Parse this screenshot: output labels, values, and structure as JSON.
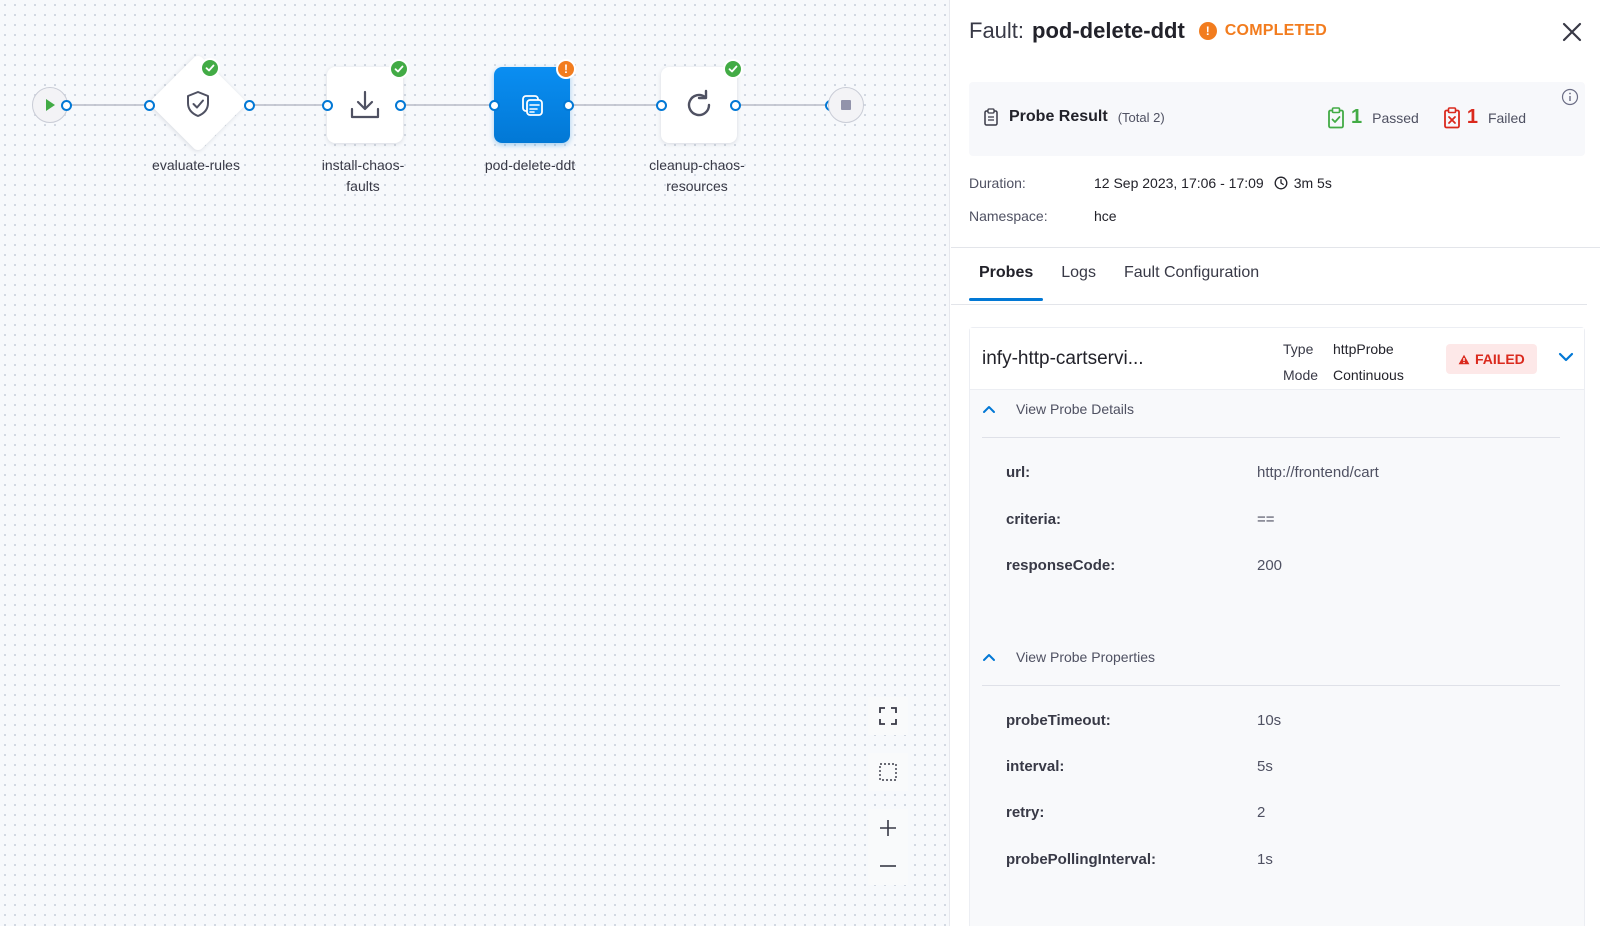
{
  "pipeline": {
    "nodes": [
      {
        "label_line1": "evaluate-rules",
        "label_line2": "",
        "status": "passed",
        "icon": "shield-check-icon"
      },
      {
        "label_line1": "install-chaos-",
        "label_line2": "faults",
        "status": "passed",
        "icon": "download-icon"
      },
      {
        "label_line1": "pod-delete-ddt",
        "label_line2": "",
        "status": "warning",
        "icon": "chaos-fault-icon"
      },
      {
        "label_line1": "cleanup-chaos-",
        "label_line2": "resources",
        "status": "passed",
        "icon": "refresh-icon"
      }
    ],
    "warning_glyph": "!"
  },
  "canvas_tools": [
    "fit-to-screen-icon",
    "select-area-icon",
    "zoom-in-icon",
    "zoom-out-icon"
  ],
  "panel": {
    "fault_prefix": "Fault:",
    "fault_name": "pod-delete-ddt",
    "status_glyph": "!",
    "status": "COMPLETED",
    "probe_result": {
      "title": "Probe Result",
      "total": "(Total 2)",
      "passed_count": "1",
      "passed_label": "Passed",
      "failed_count": "1",
      "failed_label": "Failed"
    },
    "duration_label": "Duration:",
    "duration_value": "12 Sep 2023, 17:06 - 17:09",
    "duration_elapsed": "3m 5s",
    "namespace_label": "Namespace:",
    "namespace_value": "hce",
    "tabs": [
      "Probes",
      "Logs",
      "Fault Configuration"
    ],
    "active_tab": "Probes",
    "probe": {
      "name": "infy-http-cartservi...",
      "type_label": "Type",
      "type_value": "httpProbe",
      "mode_label": "Mode",
      "mode_value": "Continuous",
      "status": "FAILED",
      "details_title": "View Probe Details",
      "details": [
        {
          "key": "url:",
          "value": "http://frontend/cart"
        },
        {
          "key": "criteria:",
          "value": "=="
        },
        {
          "key": "responseCode:",
          "value": "200"
        }
      ],
      "properties_title": "View Probe Properties",
      "properties": [
        {
          "key": "probeTimeout:",
          "value": "10s"
        },
        {
          "key": "interval:",
          "value": "5s"
        },
        {
          "key": "retry:",
          "value": "2"
        },
        {
          "key": "probePollingInterval:",
          "value": "1s"
        }
      ]
    }
  },
  "colors": {
    "accent": "#0278d5",
    "success": "#42ab45",
    "warning": "#f27c1e",
    "danger": "#da291d"
  }
}
